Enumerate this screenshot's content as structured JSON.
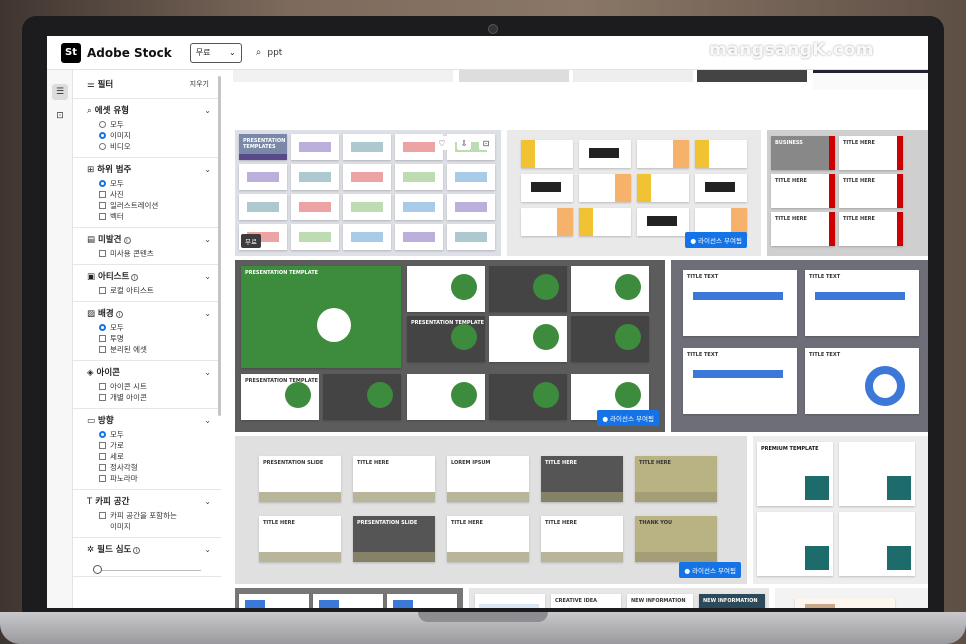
{
  "app": {
    "logo_mark": "St",
    "name": "Adobe Stock"
  },
  "search": {
    "scope": "무료",
    "query": "ppt"
  },
  "watermark": "mangsangK.com",
  "filters": {
    "title": "필터",
    "clear": "지우기",
    "sections": [
      {
        "title": "에셋 유형",
        "icon": "search-icon",
        "type": "radio",
        "options": [
          {
            "label": "모두",
            "on": false
          },
          {
            "label": "이미지",
            "on": true
          },
          {
            "label": "비디오",
            "on": false
          }
        ]
      },
      {
        "title": "하위 범주",
        "icon": "grid-icon",
        "type": "mixed",
        "options": [
          {
            "label": "모두",
            "on": true,
            "kind": "radio"
          },
          {
            "label": "사진",
            "kind": "check"
          },
          {
            "label": "일러스트레이션",
            "kind": "check"
          },
          {
            "label": "벡터",
            "kind": "check"
          }
        ]
      },
      {
        "title": "미발견",
        "icon": "calendar-icon",
        "info": true,
        "type": "check",
        "options": [
          {
            "label": "미사용 콘텐츠"
          }
        ]
      },
      {
        "title": "아티스트",
        "icon": "person-icon",
        "info": true,
        "type": "check",
        "options": [
          {
            "label": "로컬 아티스트"
          }
        ]
      },
      {
        "title": "배경",
        "icon": "image-icon",
        "info": true,
        "type": "mixed",
        "options": [
          {
            "label": "모두",
            "on": true,
            "kind": "radio"
          },
          {
            "label": "투명",
            "kind": "check"
          },
          {
            "label": "분리된 에셋",
            "kind": "check"
          }
        ]
      },
      {
        "title": "아이콘",
        "icon": "diamond-icon",
        "type": "check",
        "options": [
          {
            "label": "아이콘 시트"
          },
          {
            "label": "개별 아이콘"
          }
        ]
      },
      {
        "title": "방향",
        "icon": "rect-icon",
        "type": "mixed",
        "options": [
          {
            "label": "모두",
            "on": true,
            "kind": "radio"
          },
          {
            "label": "가로",
            "kind": "check"
          },
          {
            "label": "세로",
            "kind": "check"
          },
          {
            "label": "정사각형",
            "kind": "check"
          },
          {
            "label": "파노라마",
            "kind": "check"
          }
        ]
      },
      {
        "title": "카피 공간",
        "icon": "text-icon",
        "type": "check",
        "options": [
          {
            "label": "카피 공간을 포함하는"
          },
          {
            "label": "이미지"
          }
        ]
      },
      {
        "title": "필드 심도",
        "icon": "aperture-icon",
        "info": true,
        "type": "slider",
        "options": []
      }
    ]
  },
  "results": {
    "license_label": "라이선스 부여됨",
    "free_label": "무료",
    "slide_texts": {
      "presentation_templates": "PRESENTATION TEMPLATES",
      "presentation_template": "PRESENTATION TEMPLATE",
      "business": "BUSINESS",
      "title_here": "TITLE HERE",
      "lorem": "LOREM IPSUM",
      "thank_you": "THANK YOU",
      "presentation_slide": "PRESENTATION SLIDE",
      "premium": "PREMIUM TEMPLATE",
      "creative_idea": "CREATIVE IDEA",
      "new_information": "NEW INFORMATION",
      "title_text": "TITLE TEXT"
    }
  }
}
